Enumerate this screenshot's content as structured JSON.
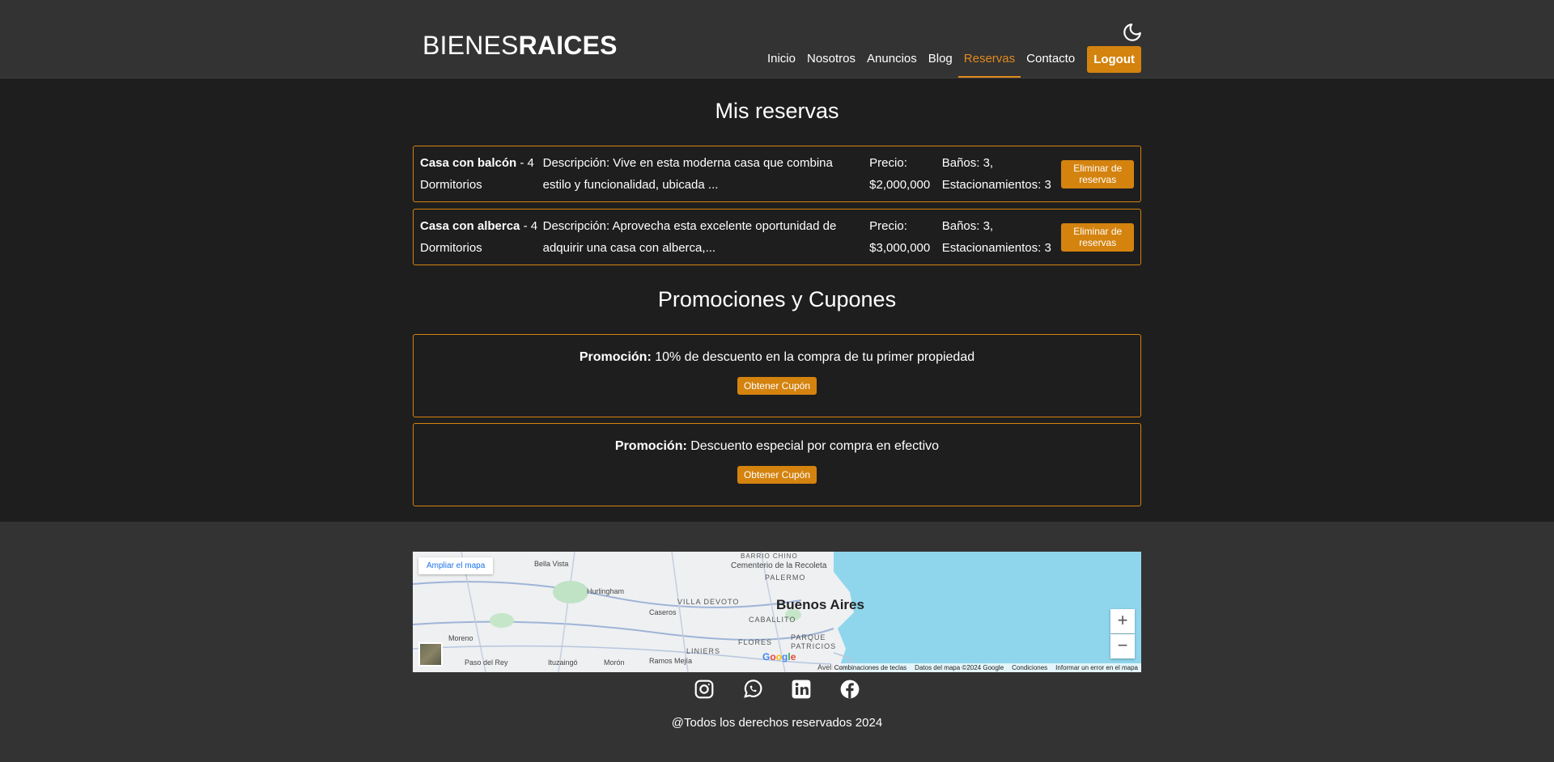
{
  "header": {
    "logo_light": "BIENES",
    "logo_bold": "RAICES",
    "nav": [
      "Inicio",
      "Nosotros",
      "Anuncios",
      "Blog",
      "Reservas",
      "Contacto"
    ],
    "active_nav": "Reservas",
    "logout_label": "Logout",
    "theme_icon": "moon-icon"
  },
  "reservas": {
    "title": "Mis reservas",
    "items": [
      {
        "name": "Casa con balcón",
        "rooms": " - 4 Dormitorios",
        "description": "Descripción: Vive en esta moderna casa que combina estilo y funcionalidad, ubicada ...",
        "price": "Precio: $2,000,000",
        "extras": "Baños: 3, Estacionamientos: 3",
        "button": "Eliminar de reservas"
      },
      {
        "name": "Casa con alberca",
        "rooms": " - 4 Dormitorios",
        "description": "Descripción: Aprovecha esta excelente oportunidad de adquirir una casa con alberca,...",
        "price": "Precio: $3,000,000",
        "extras": "Baños: 3, Estacionamientos: 3",
        "button": "Eliminar de reservas"
      }
    ]
  },
  "promociones": {
    "title": "Promociones y Cupones",
    "items": [
      {
        "label": "Promoción:",
        "text": " 10% de descuento en la compra de tu primer propiedad",
        "button": "Obtener Cupón"
      },
      {
        "label": "Promoción:",
        "text": " Descuento especial por compra en efectivo",
        "button": "Obtener Cupón"
      }
    ]
  },
  "map": {
    "enlarge_link": "Ampliar el mapa",
    "city": "Buenos Aires",
    "labels": [
      "Bella Vista",
      "BARRIO CHINO",
      "Cementerio de la Recoleta",
      "PALERMO",
      "Hurlingham",
      "VILLA DEVOTO",
      "Caseros",
      "CABALLITO",
      "Moreno",
      "FLORES",
      "PARQUE PATRICIOS",
      "LINIERS",
      "Paso del Rey",
      "Ituzaingó",
      "Morón",
      "Ramos Mejía",
      "Avellaned"
    ],
    "zoom_in": "+",
    "zoom_out": "−",
    "attribution": [
      "Combinaciones de teclas",
      "Datos del mapa ©2024 Google",
      "Condiciones",
      "Informar un error en el mapa"
    ],
    "google": "Google"
  },
  "footer": {
    "socials": [
      "instagram-icon",
      "whatsapp-icon",
      "linkedin-icon",
      "facebook-icon"
    ],
    "copyright": "@Todos los derechos reservados 2024"
  },
  "colors": {
    "accent": "#d4830f",
    "header_bg": "#333333",
    "body_bg": "#1e1e1e"
  }
}
